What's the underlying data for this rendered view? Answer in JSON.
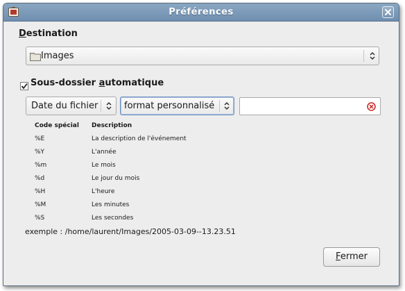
{
  "window": {
    "title": "Préférences"
  },
  "destination": {
    "label_mnemonic": "D",
    "label_rest": "estination",
    "folder_icon": "folder-icon",
    "value": "Images"
  },
  "subfolder": {
    "checked": true,
    "label_before": "Sous-dossier ",
    "label_mnemonic": "a",
    "label_after": "utomatique",
    "date_source": "Date du fichier",
    "format": "format personnalisé",
    "custom_format": ""
  },
  "codes": {
    "header_code": "Code spécial",
    "header_desc": "Description",
    "rows": [
      {
        "code": "%E",
        "desc": "La description de l'événement"
      },
      {
        "code": "%Y",
        "desc": "L'année"
      },
      {
        "code": "%m",
        "desc": "Le mois"
      },
      {
        "code": "%d",
        "desc": "Le jour du mois"
      },
      {
        "code": "%H",
        "desc": "L'heure"
      },
      {
        "code": "%M",
        "desc": "Les minutes"
      },
      {
        "code": "%S",
        "desc": "Les secondes"
      }
    ]
  },
  "example": "exemple : /home/laurent/Images/2005-03-09--13.23.51",
  "close_button": {
    "mnemonic": "F",
    "rest": "ermer"
  },
  "colors": {
    "titlebar": "#7a98b8",
    "accent_border": "#6f8fc0",
    "clear_icon": "#cc2222"
  }
}
